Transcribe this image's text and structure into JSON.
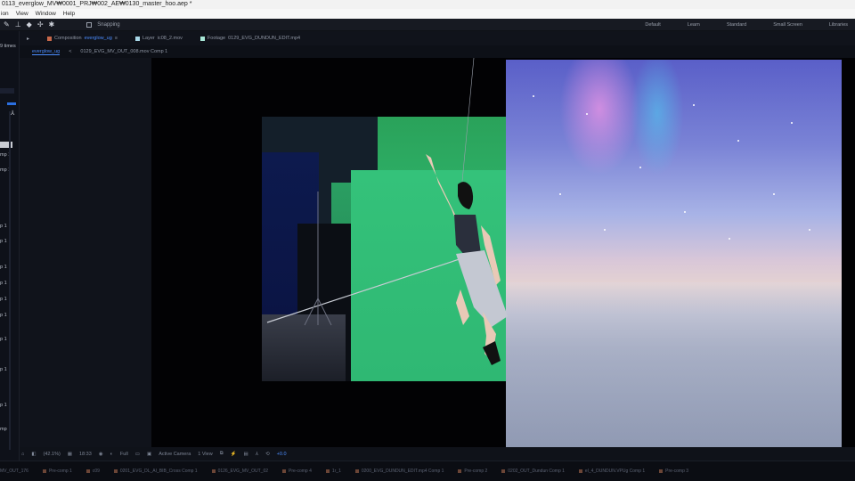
{
  "window": {
    "title": "0113_everglow_MV₩0001_PRJ₩002_AE₩0130_master_hoo.aep *"
  },
  "menu": {
    "items": [
      "ion",
      "View",
      "Window",
      "Help"
    ]
  },
  "toolbar": {
    "snapping_label": "Snapping",
    "workspaces": [
      "Default",
      "Learn",
      "Standard",
      "Small Screen",
      "Libraries"
    ]
  },
  "left_panel": {
    "times_label": "9 times",
    "rows": [
      "mp 1",
      "mp 1",
      "p 1",
      "p 1",
      "p 1",
      "p 1",
      "p 1",
      "p 1",
      "p 1",
      "p 1",
      "p 1",
      "mp"
    ]
  },
  "panel_tabs": [
    {
      "prefix": "Composition",
      "name": "everglow_ug",
      "color": "#c8684a"
    },
    {
      "prefix": "Layer",
      "name": "ic08_2.mov",
      "color": "#a8d8e8"
    },
    {
      "prefix": "Footage",
      "name": "0129_EVG_DUNDUN_EDIT.mp4",
      "color": "#a8e8d8"
    }
  ],
  "breadcrumb": {
    "items": [
      "everglow_ug",
      "0129_EVG_MV_OUT_008.mov Comp 1"
    ]
  },
  "viewer_controls": {
    "zoom": "(42.1%)",
    "timecode": "18:33",
    "resolution": "Full",
    "camera": "Active Camera",
    "views": "1 View",
    "exposure": "+0.0"
  },
  "bottom_tabs": [
    "MV_OUT_176",
    "Pre-comp 1",
    "c09",
    "0201_EVG_DL_AI_BIB_Cross Comp 1",
    "0126_EVG_MV_OUT_02",
    "Pre-comp 4",
    "1r_1",
    "0200_EVG_DUNDUN_EDIT.mp4 Comp 1",
    "Pre-comp 2",
    "0202_OUT_Dundun Comp 1",
    "el_4_DUNDUN.VPUg Comp 1",
    "Pre-comp 3"
  ]
}
